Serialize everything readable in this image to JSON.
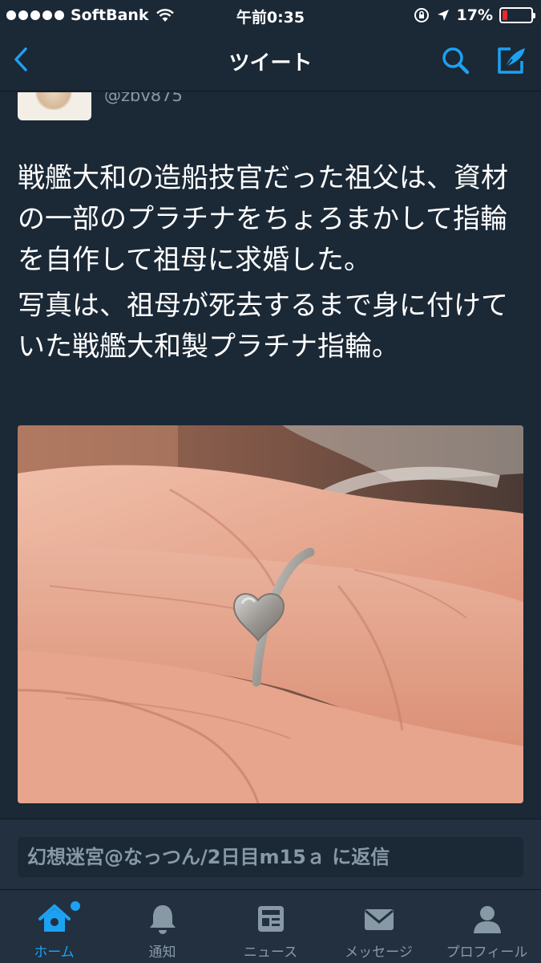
{
  "status_bar": {
    "carrier": "SoftBank",
    "time": "午前0:35",
    "battery": "17%",
    "battery_level": 0.17,
    "battery_color": "#e8262d"
  },
  "nav": {
    "title": "ツイート",
    "back_icon": "chevron-left-icon",
    "search_icon": "search-icon",
    "compose_icon": "compose-icon"
  },
  "tweet": {
    "handle": "@zbv875",
    "text_lines": [
      "戦艦大和の造船技官だった祖父は、資材の一部のプラチナをちょろまかして指輪を自作して祖母に求婚した。",
      "写真は、祖母が死去するまで身に付けていた戦艦大和製プラチナ指輪。"
    ]
  },
  "reply": {
    "placeholder": "幻想迷宮@なっつん/2日目m15ａ に返信"
  },
  "tabs": [
    {
      "label": "ホーム",
      "icon": "home-icon",
      "active": true
    },
    {
      "label": "通知",
      "icon": "bell-icon",
      "active": false
    },
    {
      "label": "ニュース",
      "icon": "news-icon",
      "active": false
    },
    {
      "label": "メッセージ",
      "icon": "envelope-icon",
      "active": false
    },
    {
      "label": "プロフィール",
      "icon": "person-icon",
      "active": false
    }
  ],
  "colors": {
    "background": "#1b2836",
    "accent": "#1da1f2",
    "muted": "#8899a6"
  }
}
